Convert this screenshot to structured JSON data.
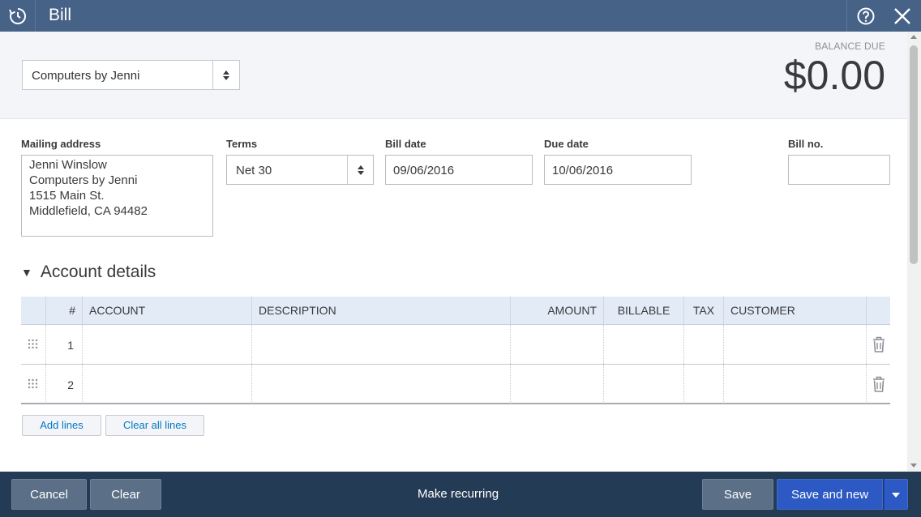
{
  "titlebar": {
    "title": "Bill"
  },
  "header": {
    "vendor": "Computers by Jenni",
    "balance_label": "BALANCE DUE",
    "balance_amount": "$0.00"
  },
  "fields": {
    "mailing_label": "Mailing address",
    "address_lines": [
      "Jenni Winslow",
      "Computers by Jenni",
      "1515 Main St.",
      "Middlefield, CA  94482"
    ],
    "terms_label": "Terms",
    "terms_value": "Net 30",
    "bill_date_label": "Bill date",
    "bill_date_value": "09/06/2016",
    "due_date_label": "Due date",
    "due_date_value": "10/06/2016",
    "bill_no_label": "Bill no.",
    "bill_no_value": ""
  },
  "account_details": {
    "title": "Account details",
    "columns": [
      "#",
      "ACCOUNT",
      "DESCRIPTION",
      "AMOUNT",
      "BILLABLE",
      "TAX",
      "CUSTOMER"
    ],
    "rows": [
      {
        "num": "1",
        "account": "",
        "description": "",
        "amount": "",
        "billable": "",
        "tax": "",
        "customer": ""
      },
      {
        "num": "2",
        "account": "",
        "description": "",
        "amount": "",
        "billable": "",
        "tax": "",
        "customer": ""
      }
    ],
    "add_lines": "Add lines",
    "clear_all_lines": "Clear all lines"
  },
  "footer": {
    "cancel": "Cancel",
    "clear": "Clear",
    "make_recurring": "Make recurring",
    "save": "Save",
    "save_and_new": "Save and new"
  },
  "colors": {
    "titlebar": "#466286",
    "footer": "#243b55",
    "primary_button": "#2c59c4",
    "link": "#0077c5"
  }
}
